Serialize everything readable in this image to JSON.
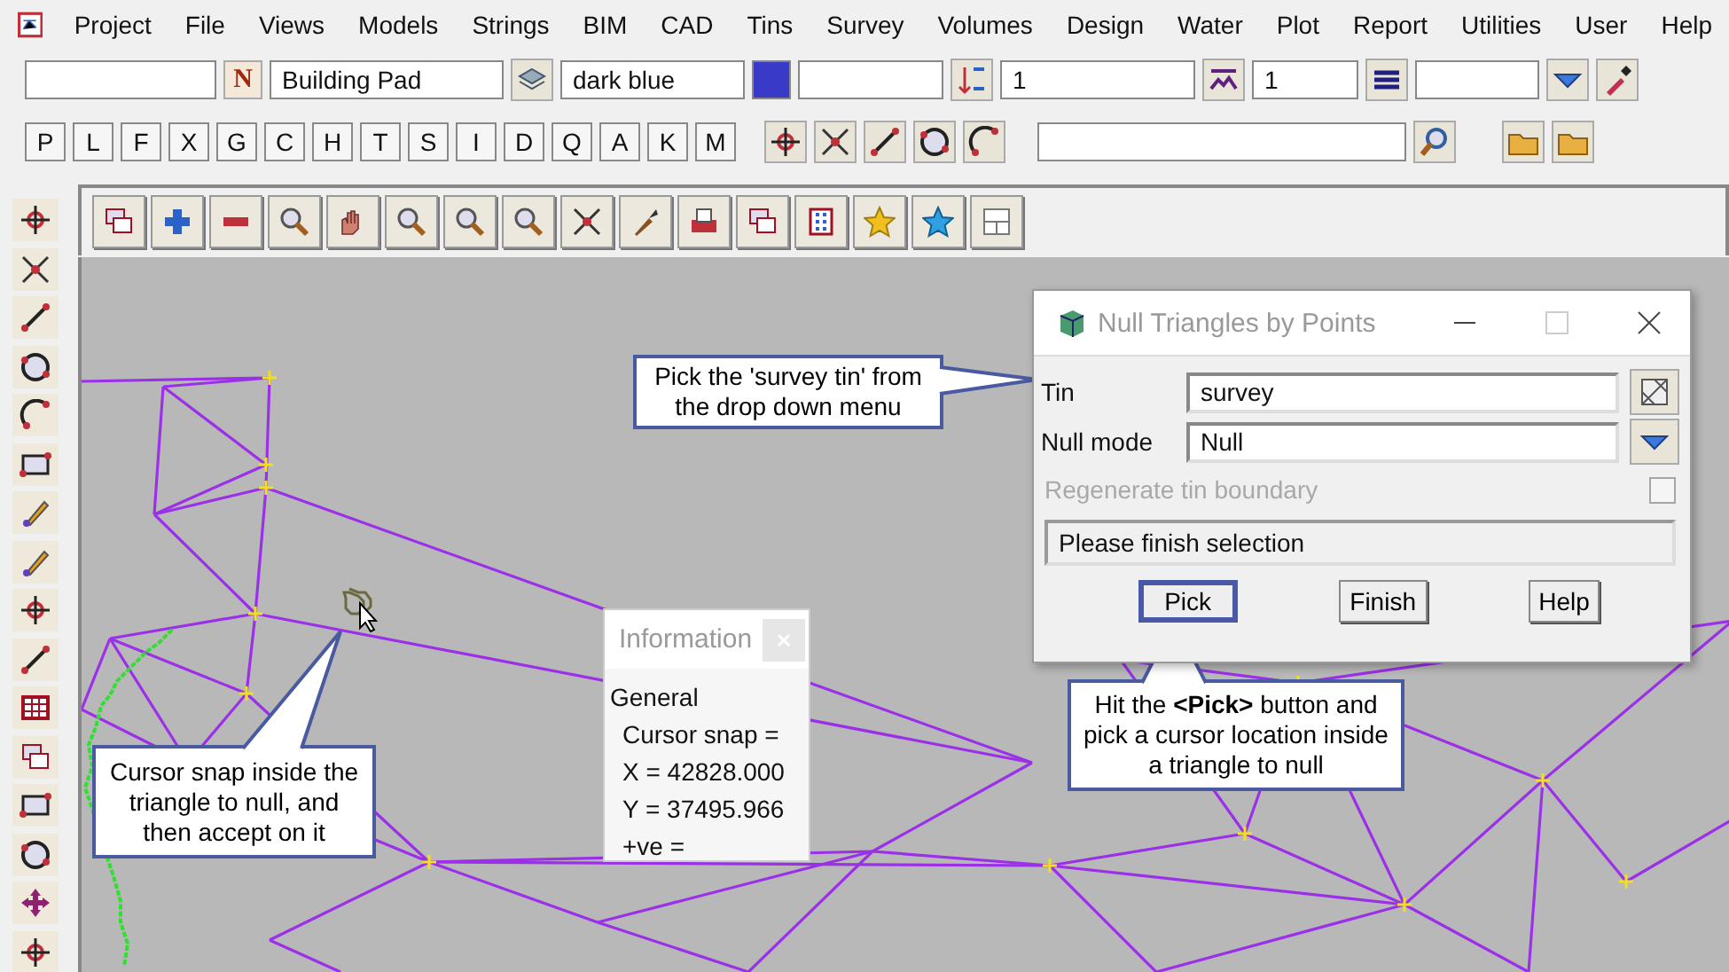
{
  "menu": {
    "items": [
      "Project",
      "File",
      "Views",
      "Models",
      "Strings",
      "BIM",
      "CAD",
      "Tins",
      "Survey",
      "Volumes",
      "Design",
      "Water",
      "Plot",
      "Report",
      "Utilities",
      "User",
      "Help"
    ]
  },
  "toolbar": {
    "name_button": "N",
    "model_field": "Building Pad",
    "colour_field": "dark blue",
    "height_field": "1",
    "weight_field": "1"
  },
  "mode_keys": [
    {
      "label": "P"
    },
    {
      "label": "L"
    },
    {
      "label": "F"
    },
    {
      "label": "X"
    },
    {
      "label": "G"
    },
    {
      "label": "C"
    },
    {
      "label": "H"
    },
    {
      "label": "T"
    },
    {
      "label": "S"
    },
    {
      "label": "I"
    },
    {
      "label": "D"
    },
    {
      "label": "Q"
    },
    {
      "label": "A"
    },
    {
      "label": "K"
    },
    {
      "label": "M"
    }
  ],
  "dialog": {
    "title": "Null Triangles by Points",
    "fields": [
      {
        "label": "Tin",
        "value": "survey",
        "kind": "picker"
      },
      {
        "label": "Null mode",
        "value": "Null",
        "kind": "dropdown"
      }
    ],
    "option": {
      "label": "Regenerate tin boundary",
      "checked": false,
      "disabled": true
    },
    "status": "Please finish selection",
    "buttons": [
      {
        "label": "Pick",
        "selected": true
      },
      {
        "label": "Finish",
        "selected": false
      },
      {
        "label": "Help",
        "selected": false
      }
    ]
  },
  "info_panel": {
    "title": "Information",
    "heading": "General",
    "lines": [
      "Cursor snap =",
      "X = 42828.000",
      "Y = 37495.966",
      "+ve ="
    ]
  },
  "callouts": [
    {
      "text": "Pick the 'survey tin' from the drop down menu"
    },
    {
      "text": "Hit the **<Pick>** button and pick a cursor location inside a triangle to null"
    },
    {
      "text": "Cursor snap inside the triangle to null, and then accept on it"
    }
  ]
}
